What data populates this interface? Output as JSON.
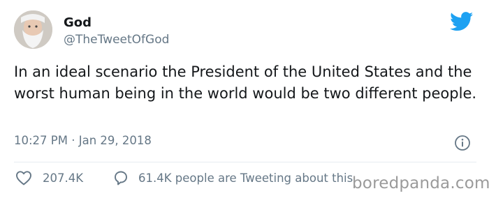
{
  "author": {
    "name": "God",
    "handle": "@TheTweetOfGod"
  },
  "tweet": {
    "text": "In an ideal scenario the President of the United States and the worst human being in the world would be two different people.",
    "timestamp": "10:27 PM · Jan 29, 2018"
  },
  "actions": {
    "like_count": "207.4K",
    "reply_text": "61.4K people are Tweeting about this"
  },
  "icons": {
    "brand": "twitter-bird-icon",
    "info": "info-icon",
    "like": "heart-icon",
    "reply": "speech-bubble-icon"
  },
  "colors": {
    "brand_blue": "#1da1f2",
    "text": "#14171a",
    "secondary": "#657786",
    "divider": "#e6ecf0"
  },
  "watermark": {
    "text": "boredpanda.com"
  }
}
